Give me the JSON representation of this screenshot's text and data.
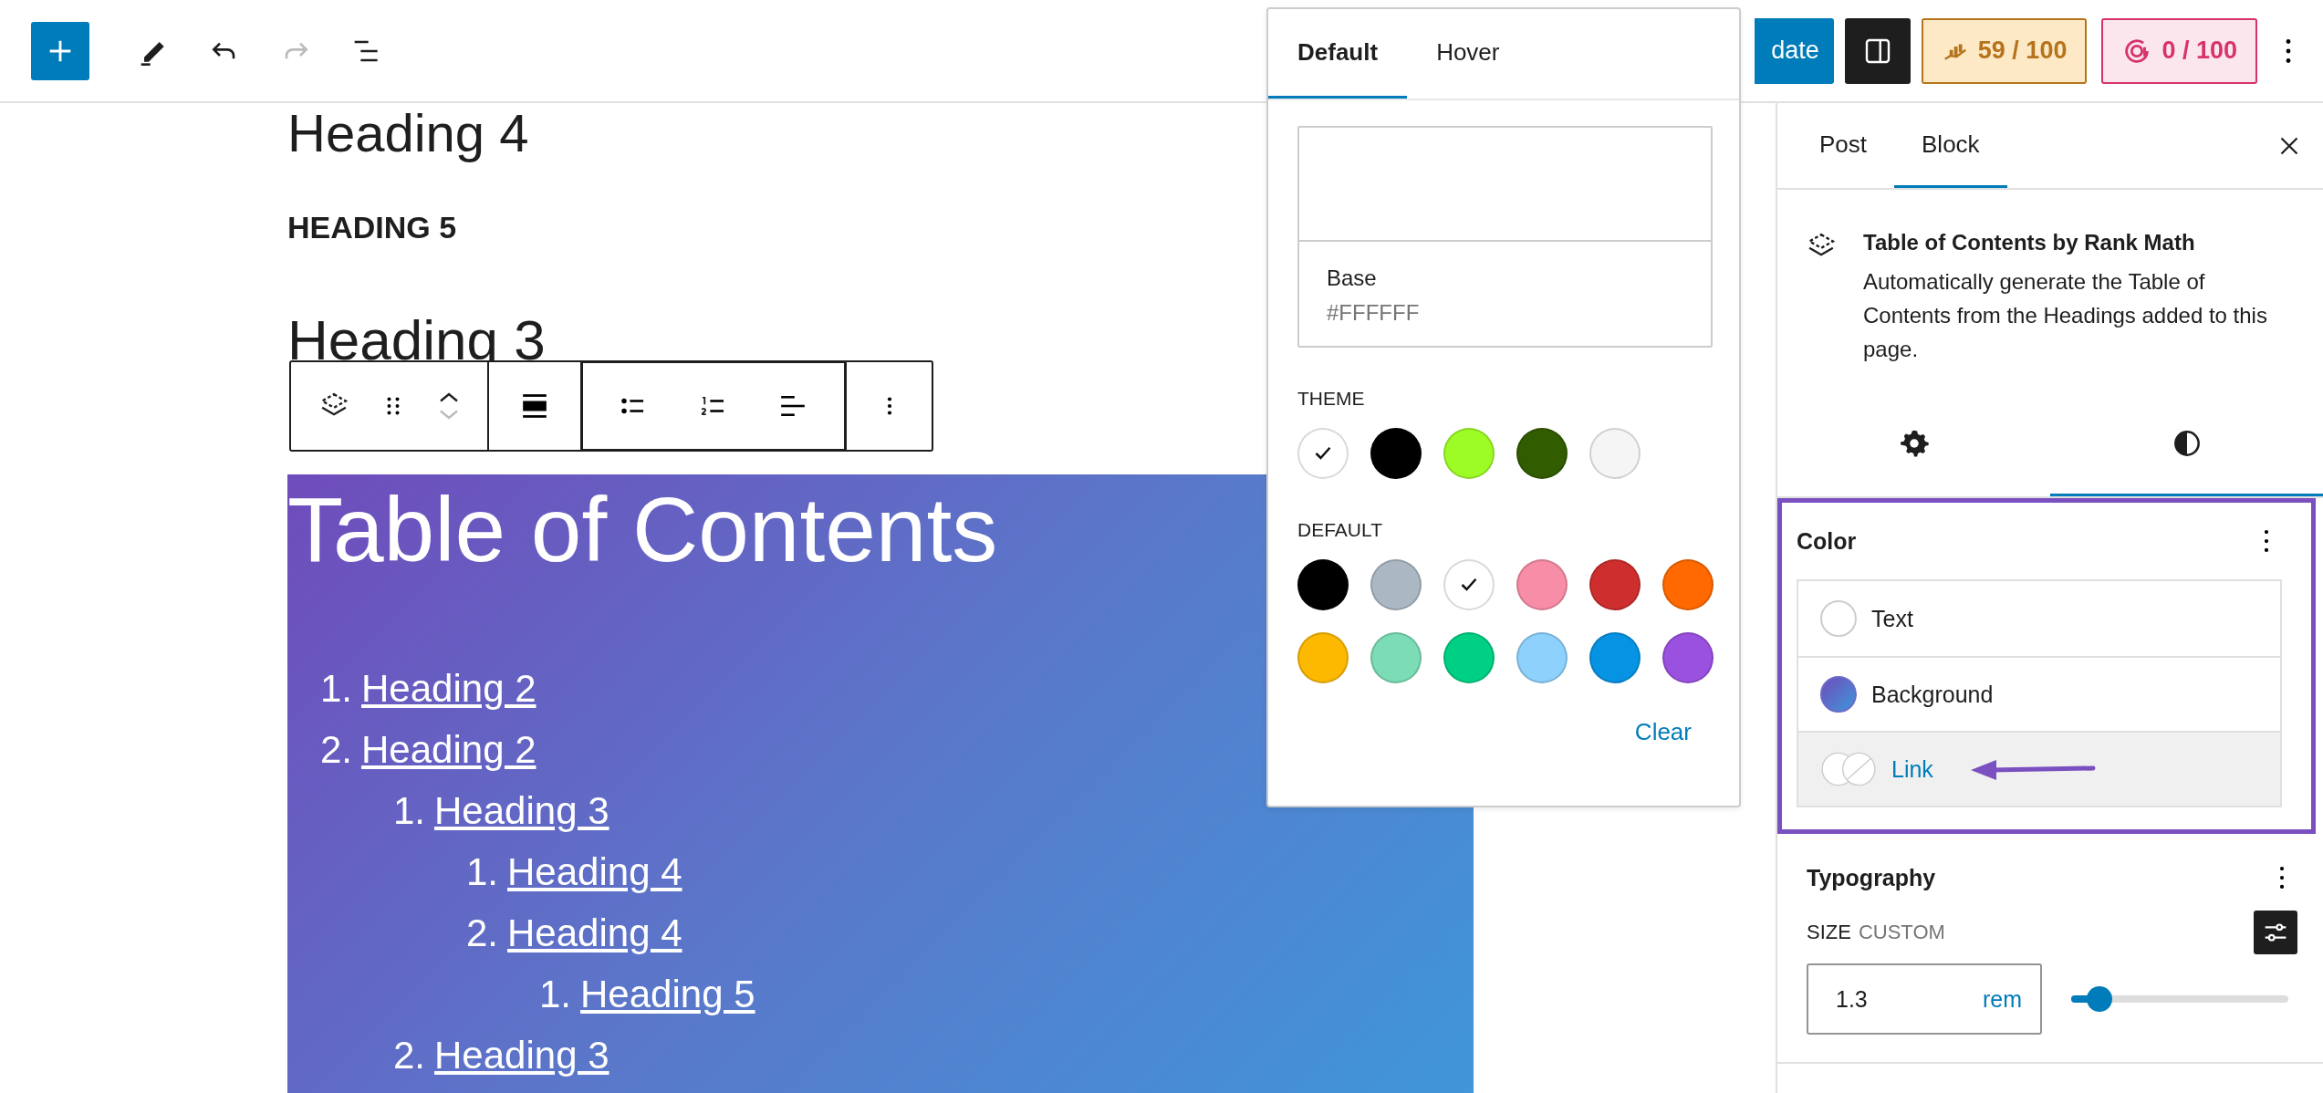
{
  "top_bar": {
    "redo_disabled": true,
    "update_button": "date",
    "rank_score": "59 / 100",
    "ai_score": "0 / 100"
  },
  "headings": [
    {
      "kind": "h4",
      "text": "Heading 4"
    },
    {
      "kind": "h5",
      "text": "HEADING 5"
    },
    {
      "kind": "h3",
      "text": "Heading 3"
    }
  ],
  "toc": {
    "title": "Table of Contents",
    "items": [
      {
        "number": "1.",
        "text": "Heading 2"
      },
      {
        "number": "2.",
        "text": "Heading 2",
        "children": [
          {
            "number": "1.",
            "text": "Heading 3",
            "children": [
              {
                "number": "1.",
                "text": "Heading 4"
              },
              {
                "number": "2.",
                "text": "Heading 4",
                "children": [
                  {
                    "number": "1.",
                    "text": "Heading 5"
                  }
                ]
              }
            ]
          },
          {
            "number": "2.",
            "text": "Heading 3"
          }
        ]
      }
    ]
  },
  "popover": {
    "tabs": [
      {
        "label": "Default",
        "selected": true
      },
      {
        "label": "Hover",
        "selected": false
      }
    ],
    "preview": {
      "name": "Base",
      "value": "#FFFFFF"
    },
    "palettes": [
      {
        "title": "THEME",
        "swatches": [
          {
            "color": "#ffffff",
            "selected": true
          },
          {
            "color": "#000000",
            "selected": false
          },
          {
            "color": "#9efc26",
            "selected": false
          },
          {
            "color": "#325c00",
            "selected": false
          },
          {
            "color": "#f5f5f5",
            "selected": false
          }
        ]
      },
      {
        "title": "DEFAULT",
        "swatches": [
          {
            "color": "#000000",
            "selected": false
          },
          {
            "color": "#abb8c3",
            "selected": false
          },
          {
            "color": "#ffffff",
            "selected": true
          },
          {
            "color": "#f78da7",
            "selected": false
          },
          {
            "color": "#cf2e2e",
            "selected": false
          },
          {
            "color": "#ff6900",
            "selected": false
          },
          {
            "color": "#fcb900",
            "selected": false
          },
          {
            "color": "#7bdcb5",
            "selected": false
          },
          {
            "color": "#00d084",
            "selected": false
          },
          {
            "color": "#8ed1fc",
            "selected": false
          },
          {
            "color": "#0693e3",
            "selected": false
          },
          {
            "color": "#9b51e0",
            "selected": false
          }
        ]
      }
    ],
    "clear": "Clear"
  },
  "sidebar": {
    "tabs": [
      {
        "label": "Post",
        "selected": false
      },
      {
        "label": "Block",
        "selected": true
      }
    ],
    "block": {
      "title": "Table of Contents by Rank Math",
      "description": "Automatically generate the Table of Contents from the Headings added to this page."
    },
    "panel_tabs": [
      {
        "kind": "settings",
        "selected": false
      },
      {
        "kind": "styles",
        "selected": true
      }
    ],
    "color_panel": {
      "title": "Color",
      "items": [
        {
          "kind": "solid",
          "label": "Text",
          "color": "#ffffff",
          "active": false
        },
        {
          "kind": "gradient",
          "label": "Background",
          "active": false
        },
        {
          "kind": "pair",
          "label": "Link",
          "active": true
        }
      ]
    },
    "typography": {
      "title": "Typography",
      "size_label": "SIZE",
      "size_hint": "CUSTOM",
      "size_value": "1.3",
      "unit": "rem",
      "level": 0.13
    }
  }
}
